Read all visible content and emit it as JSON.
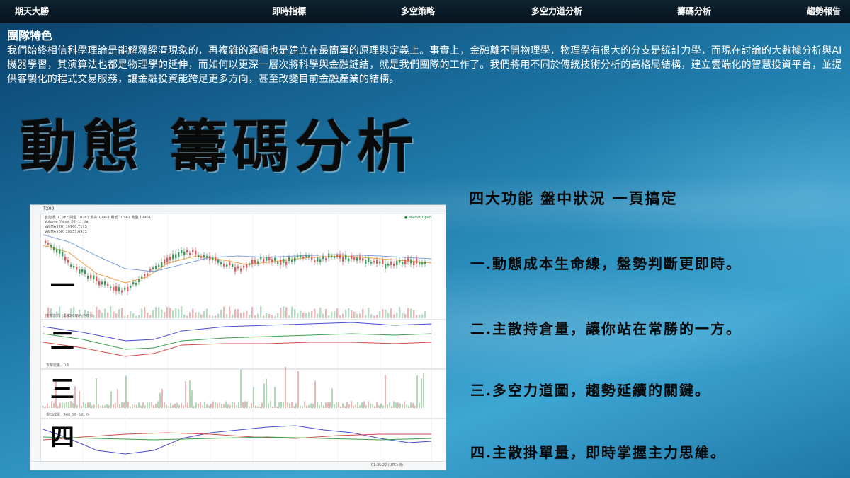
{
  "nav": {
    "items": [
      {
        "label": "期天大勝"
      },
      {
        "label": "即時指標"
      },
      {
        "label": "多空策略"
      },
      {
        "label": "多空力道分析"
      },
      {
        "label": "籌碼分析"
      },
      {
        "label": "趨勢報告"
      }
    ]
  },
  "intro": {
    "title": "團隊特色",
    "body": "我們始終相信科學理論是能解釋經濟現象的，再複雜的邏輯也是建立在最簡單的原理與定義上。事實上，金融離不開物理學，物理學有很大的分支是統計力學，而現在討論的大數據分析與AI機器學習，其演算法也都是物理學的延伸，而如何以更深一層次將科學與金融鏈結，就是我們團隊的工作了。我們將用不同於傳統技術分析的高格局結構，建立雲端化的智慧投資平台，並提供客製化的程式交易服務，讓金融投資能跨足更多方向，甚至改變目前金融產業的結構。"
  },
  "banner": {
    "title": "動態 籌碼分析"
  },
  "chart_panel": {
    "ticker": "TX00",
    "legend": [
      "台指近, 1, TFE  開盤 10961 最高 10961 最低 10961 收盤 10961",
      "Volume (false, 20)   1, n/a",
      "VWMA (20)   10960.7115",
      "VWMA (60)   10957.6971"
    ],
    "market_status": "● Market Open",
    "pane_labels": [
      "主散方向 · 1.43K  694  745  0",
      "攻擊能量 · 0  0",
      "委口成單 · 460  86  -591  0"
    ],
    "numerals": [
      "一",
      "二",
      "三",
      "四"
    ],
    "time_readout": "01:35:22 (UTC+8)"
  },
  "features": {
    "heading": "四大功能  盤中狀況  一頁搞定",
    "items": [
      "一.動態成本生命線，盤勢判斷更即時。",
      "二.主散持倉量，讓你站在常勝的一方。",
      "三.多空力道圖，趨勢延續的關鍵。",
      "四.主散掛單量，即時掌握主力思維。"
    ]
  }
}
